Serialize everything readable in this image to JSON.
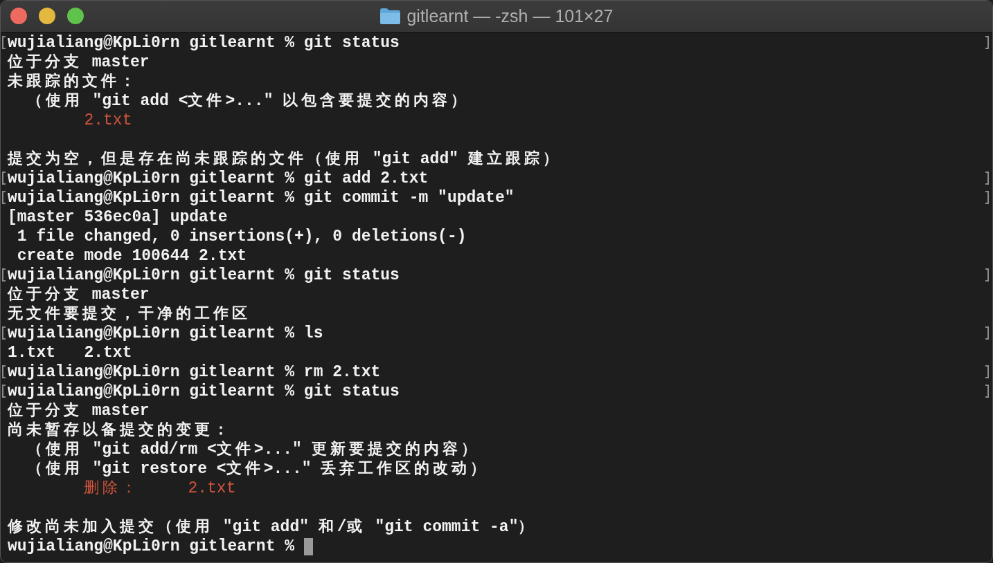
{
  "window": {
    "title": "gitlearnt — -zsh — 101×27"
  },
  "lines": [
    {
      "kind": "output",
      "marked": true,
      "text": "wujialiang@KpLi0rn gitlearnt % git status"
    },
    {
      "kind": "output",
      "marked": false,
      "text": "位于分支 master"
    },
    {
      "kind": "output",
      "marked": false,
      "text": "未跟踪的文件："
    },
    {
      "kind": "output",
      "marked": false,
      "text": "  （使用 \"git add <文件>...\" 以包含要提交的内容）"
    },
    {
      "kind": "error",
      "marked": false,
      "text": "        2.txt"
    },
    {
      "kind": "blank",
      "marked": false
    },
    {
      "kind": "output",
      "marked": false,
      "text": "提交为空，但是存在尚未跟踪的文件（使用 \"git add\" 建立跟踪）"
    },
    {
      "kind": "output",
      "marked": true,
      "text": "wujialiang@KpLi0rn gitlearnt % git add 2.txt"
    },
    {
      "kind": "output",
      "marked": true,
      "text": "wujialiang@KpLi0rn gitlearnt % git commit -m \"update\""
    },
    {
      "kind": "output",
      "marked": false,
      "text": "[master 536ec0a] update"
    },
    {
      "kind": "output",
      "marked": false,
      "text": " 1 file changed, 0 insertions(+), 0 deletions(-)"
    },
    {
      "kind": "output",
      "marked": false,
      "text": " create mode 100644 2.txt"
    },
    {
      "kind": "output",
      "marked": true,
      "text": "wujialiang@KpLi0rn gitlearnt % git status"
    },
    {
      "kind": "output",
      "marked": false,
      "text": "位于分支 master"
    },
    {
      "kind": "output",
      "marked": false,
      "text": "无文件要提交，干净的工作区"
    },
    {
      "kind": "output",
      "marked": true,
      "text": "wujialiang@KpLi0rn gitlearnt % ls"
    },
    {
      "kind": "output",
      "marked": false,
      "text": "1.txt   2.txt"
    },
    {
      "kind": "output",
      "marked": true,
      "text": "wujialiang@KpLi0rn gitlearnt % rm 2.txt"
    },
    {
      "kind": "output",
      "marked": true,
      "text": "wujialiang@KpLi0rn gitlearnt % git status"
    },
    {
      "kind": "output",
      "marked": false,
      "text": "位于分支 master"
    },
    {
      "kind": "output",
      "marked": false,
      "text": "尚未暂存以备提交的变更："
    },
    {
      "kind": "output",
      "marked": false,
      "text": "  （使用 \"git add/rm <文件>...\" 更新要提交的内容）"
    },
    {
      "kind": "output",
      "marked": false,
      "text": "  （使用 \"git restore <文件>...\" 丢弃工作区的改动）"
    },
    {
      "kind": "error",
      "marked": false,
      "text": "        删除：     2.txt"
    },
    {
      "kind": "blank",
      "marked": false
    },
    {
      "kind": "output",
      "marked": false,
      "text": "修改尚未加入提交（使用 \"git add\" 和/或 \"git commit -a\"）"
    }
  ],
  "prompt": {
    "text": "wujialiang@KpLi0rn gitlearnt %",
    "cursor": true
  }
}
